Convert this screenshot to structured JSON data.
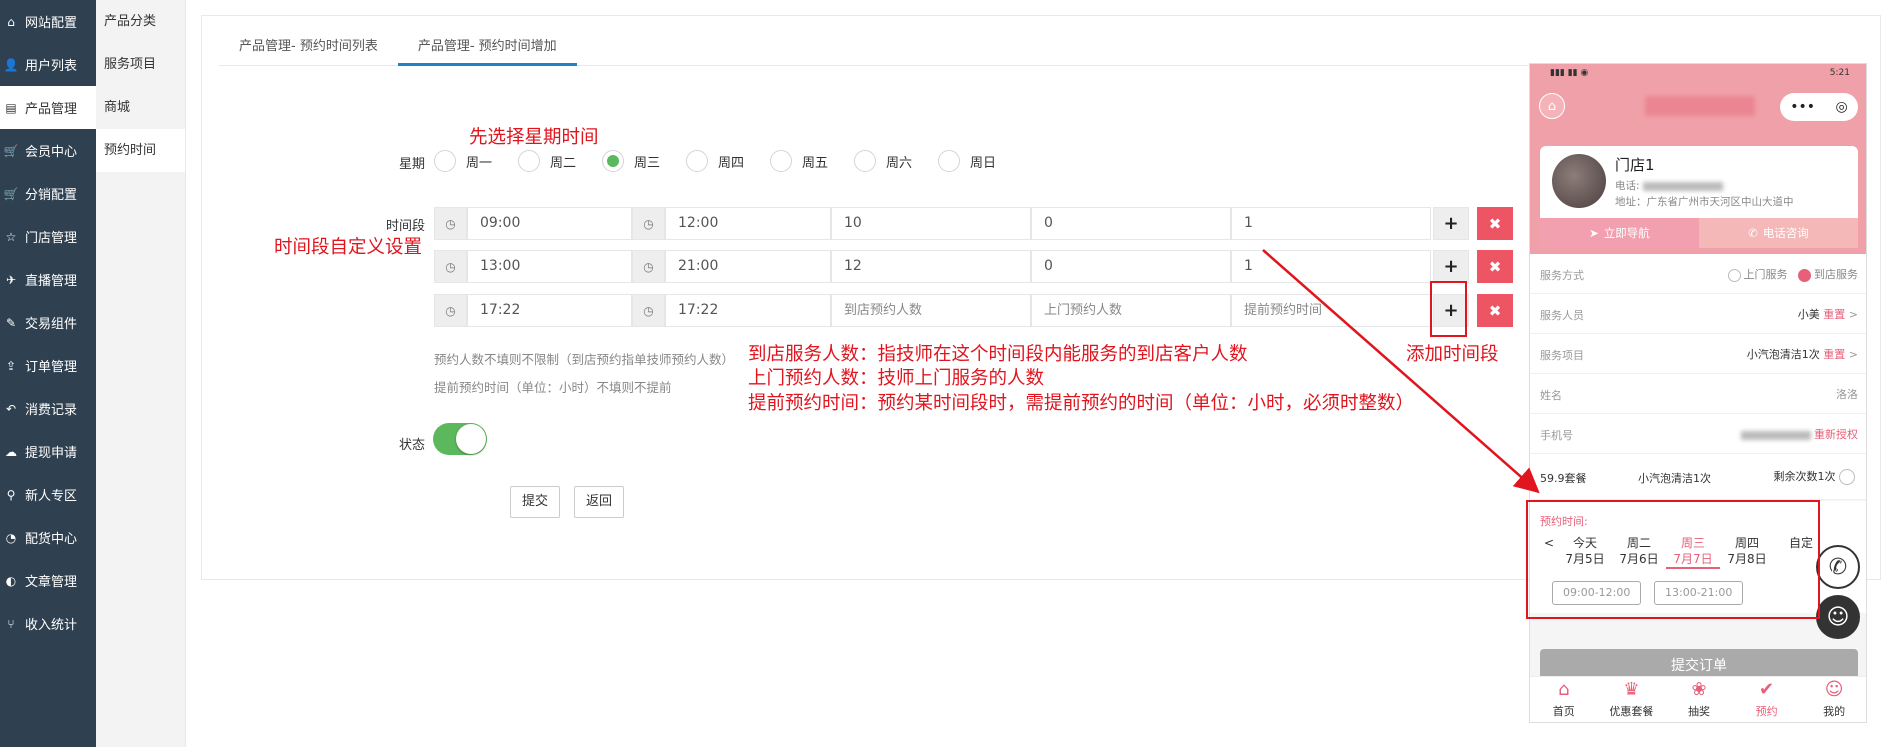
{
  "sidebar": {
    "items": [
      {
        "icon": "home-icon",
        "glyph": "⌂",
        "label": "网站配置"
      },
      {
        "icon": "user-icon",
        "glyph": "👤",
        "label": "用户列表"
      },
      {
        "icon": "server-icon",
        "glyph": "▤",
        "label": "产品管理"
      },
      {
        "icon": "cart-icon",
        "glyph": "🛒",
        "label": "会员中心"
      },
      {
        "icon": "cart-icon",
        "glyph": "🛒",
        "label": "分销配置"
      },
      {
        "icon": "star-icon",
        "glyph": "☆",
        "label": "门店管理"
      },
      {
        "icon": "plane-icon",
        "glyph": "✈",
        "label": "直播管理"
      },
      {
        "icon": "eraser-icon",
        "glyph": "✎",
        "label": "交易组件"
      },
      {
        "icon": "share-icon",
        "glyph": "⇪",
        "label": "订单管理"
      },
      {
        "icon": "reply-icon",
        "glyph": "↶",
        "label": "消费记录"
      },
      {
        "icon": "wechat-icon",
        "glyph": "☁",
        "label": "提现申请"
      },
      {
        "icon": "marker-icon",
        "glyph": "⚲",
        "label": "新人专区"
      },
      {
        "icon": "pie-icon",
        "glyph": "◔",
        "label": "配货中心"
      },
      {
        "icon": "contrast-icon",
        "glyph": "◐",
        "label": "文章管理"
      },
      {
        "icon": "fork-icon",
        "glyph": "⑂",
        "label": "收入统计"
      }
    ],
    "active_index": 2
  },
  "submenu": {
    "items": [
      "产品分类",
      "服务项目",
      "商城",
      "预约时间"
    ],
    "active_index": 3
  },
  "tabs": [
    {
      "label": "产品管理- 预约时间列表"
    },
    {
      "label": "产品管理- 预约时间增加"
    }
  ],
  "form": {
    "week_label": "星期",
    "weekdays": [
      "周一",
      "周二",
      "周三",
      "周四",
      "周五",
      "周六",
      "周日"
    ],
    "selected_weekday": 2,
    "time_label": "时间段",
    "rows": [
      {
        "start": "09:00",
        "end": "12:00",
        "store": "10",
        "home": "0",
        "advance": "1",
        "store_ph": "",
        "home_ph": "",
        "advance_ph": ""
      },
      {
        "start": "13:00",
        "end": "21:00",
        "store": "12",
        "home": "0",
        "advance": "1",
        "store_ph": "",
        "home_ph": "",
        "advance_ph": ""
      },
      {
        "start": "17:22",
        "end": "17:22",
        "store": "",
        "home": "",
        "advance": "",
        "store_ph": "到店预约人数",
        "home_ph": "上门预约人数",
        "advance_ph": "提前预约时间"
      }
    ],
    "hint1": "预约人数不填则不限制（到店预约指单技师预约人数）",
    "hint2": "提前预约时间（单位：小时）不填则不提前",
    "status_label": "状态",
    "status_on": true,
    "submit": "提交",
    "back": "返回"
  },
  "annotations": {
    "week_note": "先选择星期时间",
    "time_note": "时间段自定义设置",
    "add_note": "添加时间段",
    "store_note": "到店服务人数：指技师在这个时间段内能服务的到店客户人数",
    "home_note": "上门预约人数：技师上门服务的人数",
    "advance_note": "提前预约时间：预约某时间段时，需提前预约的时间（单位：小时，必须时整数）",
    "color": "#e0151e"
  },
  "phone": {
    "time": "5:21",
    "shop_name": "门店1",
    "phone_label": "电话:",
    "address": "地址：广东省广州市天河区中山大道中",
    "nav_btn": "立即导航",
    "call_btn": "电话咨询",
    "service_mode_label": "服务方式",
    "mode_home": "上门服务",
    "mode_store": "到店服务",
    "staff_label": "服务人员",
    "staff_value": "小美",
    "reset": "重置",
    "item_label": "服务项目",
    "item_value": "小汽泡清洁1次",
    "name_label": "姓名",
    "name_value": "洛洛",
    "mobile_label": "手机号",
    "reauth": "重新授权",
    "package_name": "59.9套餐",
    "package_item": "小汽泡清洁1次",
    "package_left": "剩余次数1次",
    "appt_label": "预约时间:",
    "days": [
      {
        "w": "今天",
        "d": "7月5日"
      },
      {
        "w": "周二",
        "d": "7月6日"
      },
      {
        "w": "周三",
        "d": "7月7日"
      },
      {
        "w": "周四",
        "d": "7月8日"
      },
      {
        "w": "自定",
        "d": ""
      }
    ],
    "selected_day": 2,
    "slots": [
      "09:00-12:00",
      "13:00-21:00"
    ],
    "submit": "提交订单",
    "tabbar": [
      {
        "glyph": "⌂",
        "label": "首页"
      },
      {
        "glyph": "♛",
        "label": "优惠套餐"
      },
      {
        "glyph": "❀",
        "label": "抽奖"
      },
      {
        "glyph": "✔",
        "label": "预约"
      },
      {
        "glyph": "☺",
        "label": "我的"
      }
    ],
    "tab_active": 3,
    "accent": "#e75f78"
  }
}
